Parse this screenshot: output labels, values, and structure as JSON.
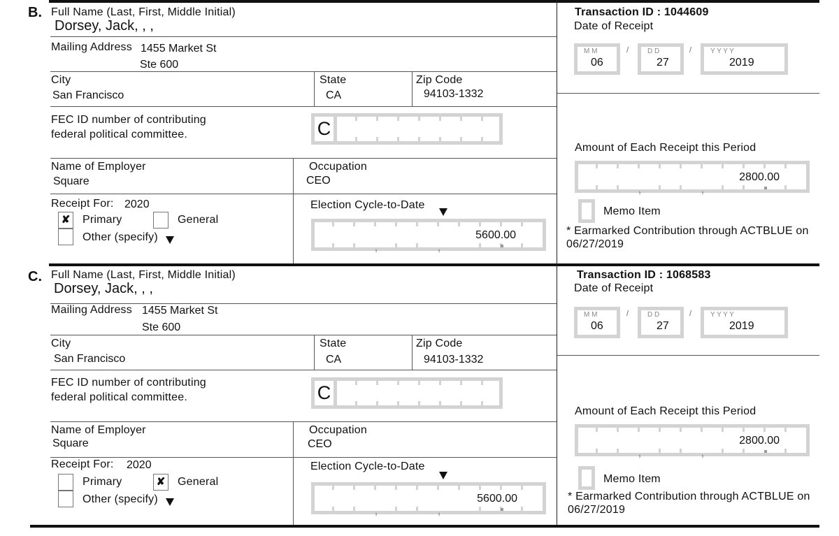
{
  "entries": [
    {
      "letter": "B.",
      "full_name_label": "Full Name (Last, First, Middle Initial)",
      "full_name": "Dorsey, Jack, , ,",
      "mailing_address_label": "Mailing Address",
      "address_line1": "1455 Market St",
      "address_line2": "Ste 600",
      "city_label": "City",
      "city": "San Francisco",
      "state_label": "State",
      "state": "CA",
      "zip_label": "Zip Code",
      "zip": "94103-1332",
      "fec_id_label_line1": "FEC ID number of contributing",
      "fec_id_label_line2": "federal political committee.",
      "fec_id_prefix": "C",
      "employer_label": "Name of Employer",
      "employer": "Square",
      "occupation_label": "Occupation",
      "occupation": "CEO",
      "receipt_for_label": "Receipt For:",
      "receipt_for_year": "2020",
      "primary_label": "Primary",
      "primary_checked": "✘",
      "general_label": "General",
      "general_checked": "",
      "other_label": "Other (specify)",
      "other_checked": "",
      "cycle_to_date_label": "Election Cycle-to-Date",
      "cycle_to_date": "5600.00",
      "transaction_id_label": "Transaction ID :",
      "transaction_id": "1044609",
      "date_label": "Date of Receipt",
      "date_mm_hint": "M  M",
      "date_dd_hint": "D  D",
      "date_yyyy_hint": "Y   Y   Y   Y",
      "date_month": "06",
      "date_day": "27",
      "date_year": "2019",
      "date_sep": "/",
      "amount_label": "Amount of Each Receipt this Period",
      "amount": "2800.00",
      "memo_label": "Memo Item",
      "note_line1": "* Earmarked Contribution through ACTBLUE on",
      "note_line2": "06/27/2019"
    },
    {
      "letter": "C.",
      "full_name_label": "Full Name (Last, First, Middle Initial)",
      "full_name": "Dorsey, Jack, , ,",
      "mailing_address_label": "Mailing Address",
      "address_line1": "1455 Market St",
      "address_line2": "Ste 600",
      "city_label": "City",
      "city": "San Francisco",
      "state_label": "State",
      "state": "CA",
      "zip_label": "Zip Code",
      "zip": "94103-1332",
      "fec_id_label_line1": "FEC ID number of contributing",
      "fec_id_label_line2": "federal political committee.",
      "fec_id_prefix": "C",
      "employer_label": "Name of Employer",
      "employer": "Square",
      "occupation_label": "Occupation",
      "occupation": "CEO",
      "receipt_for_label": "Receipt For:",
      "receipt_for_year": "2020",
      "primary_label": "Primary",
      "primary_checked": "",
      "general_label": "General",
      "general_checked": "✘",
      "other_label": "Other (specify)",
      "other_checked": "",
      "cycle_to_date_label": "Election Cycle-to-Date",
      "cycle_to_date": "5600.00",
      "transaction_id_label": "Transaction ID :",
      "transaction_id": "1068583",
      "date_label": "Date of Receipt",
      "date_mm_hint": "M  M",
      "date_dd_hint": "D  D",
      "date_yyyy_hint": "Y   Y   Y   Y",
      "date_month": "06",
      "date_day": "27",
      "date_year": "2019",
      "date_sep": "/",
      "amount_label": "Amount of Each Receipt this Period",
      "amount": "2800.00",
      "memo_label": "Memo Item",
      "note_line1": "* Earmarked Contribution through ACTBLUE on",
      "note_line2": "06/27/2019"
    }
  ]
}
